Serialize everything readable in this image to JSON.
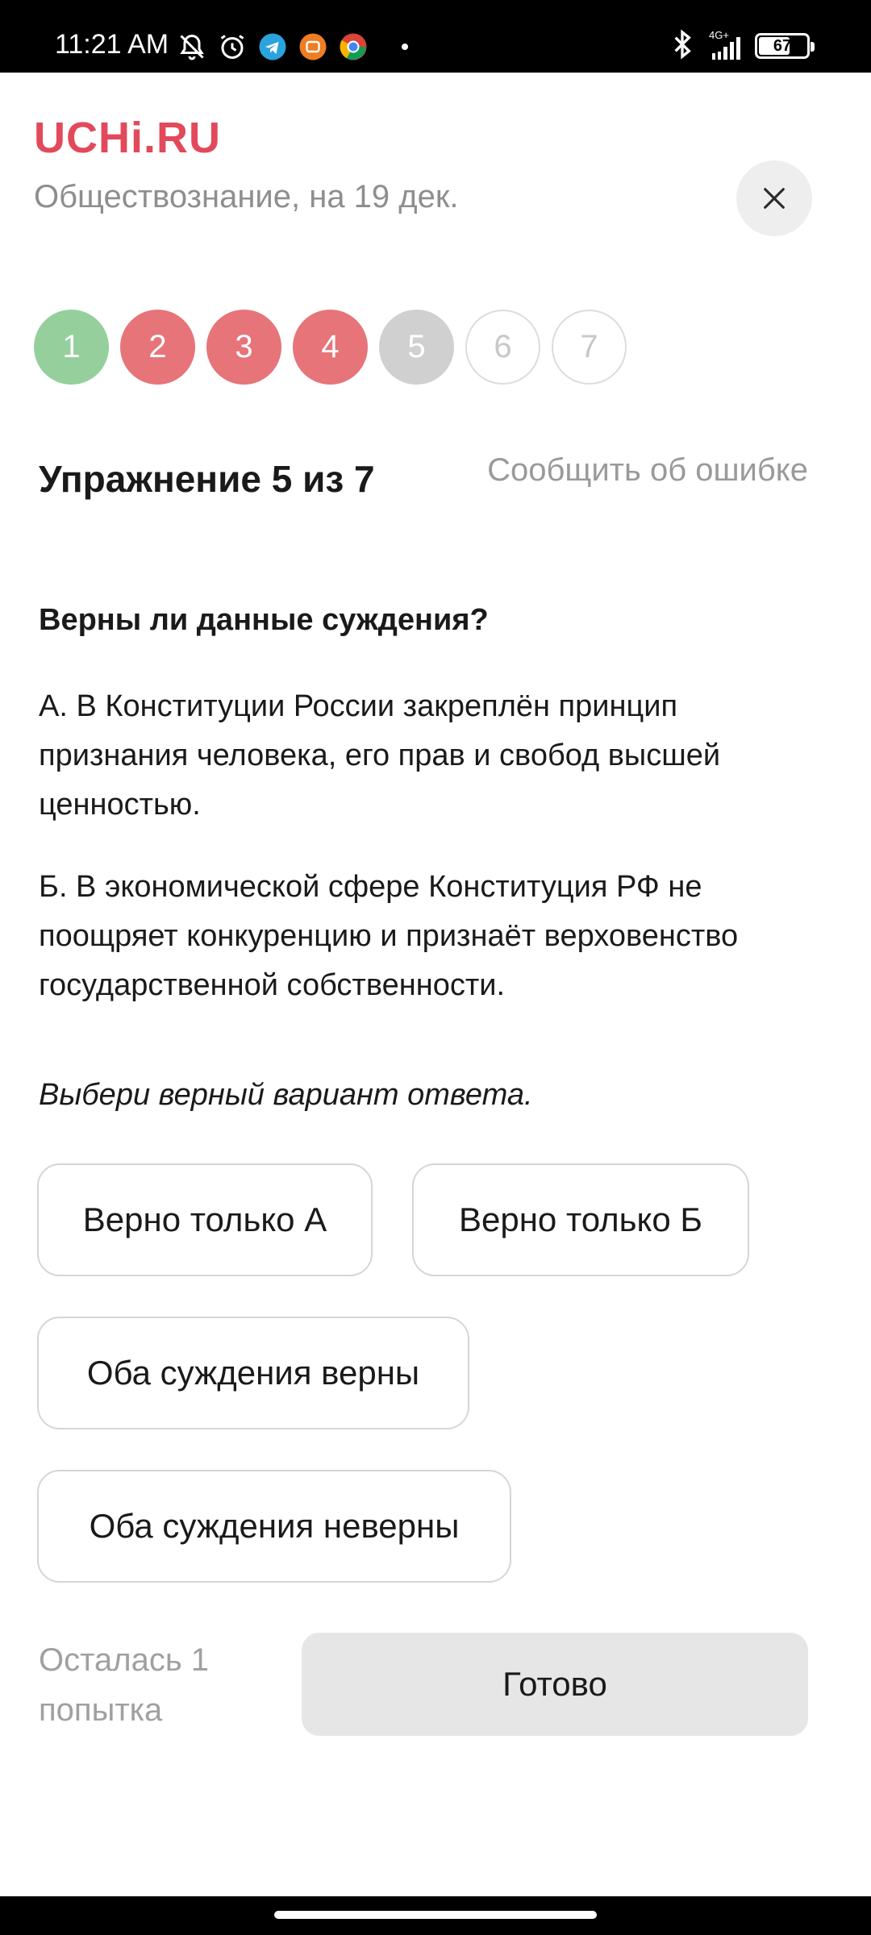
{
  "status_bar": {
    "time": "11:21 AM",
    "network": "4G+",
    "battery": "67",
    "battery_level": 0.67,
    "icons_left": [
      "mute-bell-icon",
      "alarm-icon",
      "telegram-icon",
      "mi-icon",
      "chrome-icon"
    ],
    "icons_right": [
      "bluetooth-icon",
      "signal-icon",
      "battery-icon"
    ]
  },
  "header": {
    "logo": "UCHi.RU",
    "subject": "Обществознание, на 19 дек."
  },
  "progress": {
    "steps": [
      {
        "label": "1",
        "state": "done"
      },
      {
        "label": "2",
        "state": "wrong"
      },
      {
        "label": "3",
        "state": "wrong"
      },
      {
        "label": "4",
        "state": "wrong"
      },
      {
        "label": "5",
        "state": "current"
      },
      {
        "label": "6",
        "state": "todo"
      },
      {
        "label": "7",
        "state": "todo"
      }
    ]
  },
  "exercise": {
    "title": "Упражнение 5 из 7",
    "report": "Сообщить об ошибке",
    "question": "Верны ли данные суждения?",
    "statement_a": "А. В Конституции России закреплён принцип признания человека, его прав и свобод высшей ценностью.",
    "statement_b": "Б. В экономической сфере Конституция РФ не поощряет конкуренцию и признаёт верховенство государственной собственности.",
    "instruction": "Выбери верный вариант ответа.",
    "answers": [
      "Верно только А",
      "Верно только Б",
      "Оба суждения верны",
      "Оба суждения неверны"
    ]
  },
  "footer": {
    "attempts": "Осталась 1 попытка",
    "done": "Готово"
  },
  "colors": {
    "brand": "#e2495b",
    "done": "#94cf9c",
    "wrong": "#e67479",
    "current": "#d0d0d0"
  }
}
